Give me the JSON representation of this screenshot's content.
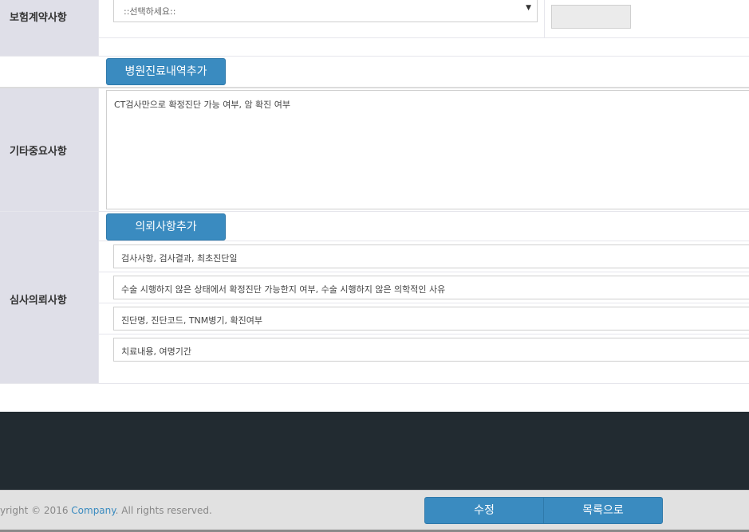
{
  "sections": {
    "insurance_contract": {
      "label": "보험계약사항",
      "select_placeholder": "::선택하세요::"
    },
    "hospital": {
      "add_button": "병원진료내역추가"
    },
    "other_important": {
      "label": "기타중요사항",
      "textarea_value": "CT검사만으로 확정진단 가능 여부, 암 확진 여부"
    },
    "review_request": {
      "label": "심사의뢰사항",
      "add_button": "의뢰사항추가",
      "items": [
        "검사사항, 검사결과, 최초진단일",
        "수술 시행하지 않은 상태에서 확정진단 가능한지 여부, 수술 시행하지 않은 의학적인 사유",
        "진단명, 진단코드, TNM병기, 확진여부",
        "치료내용, 여명기간"
      ]
    }
  },
  "footer": {
    "copyright_prefix": "yright © 2016 ",
    "company": "Company",
    "copyright_suffix": ". All rights reserved.",
    "edit_button": "수정",
    "list_button": "목록으로"
  },
  "colors": {
    "accent": "#3a8bc0",
    "label_bg": "#dfdfe8",
    "footer_dark": "#222b31",
    "footer_light": "#e1e1e1"
  }
}
